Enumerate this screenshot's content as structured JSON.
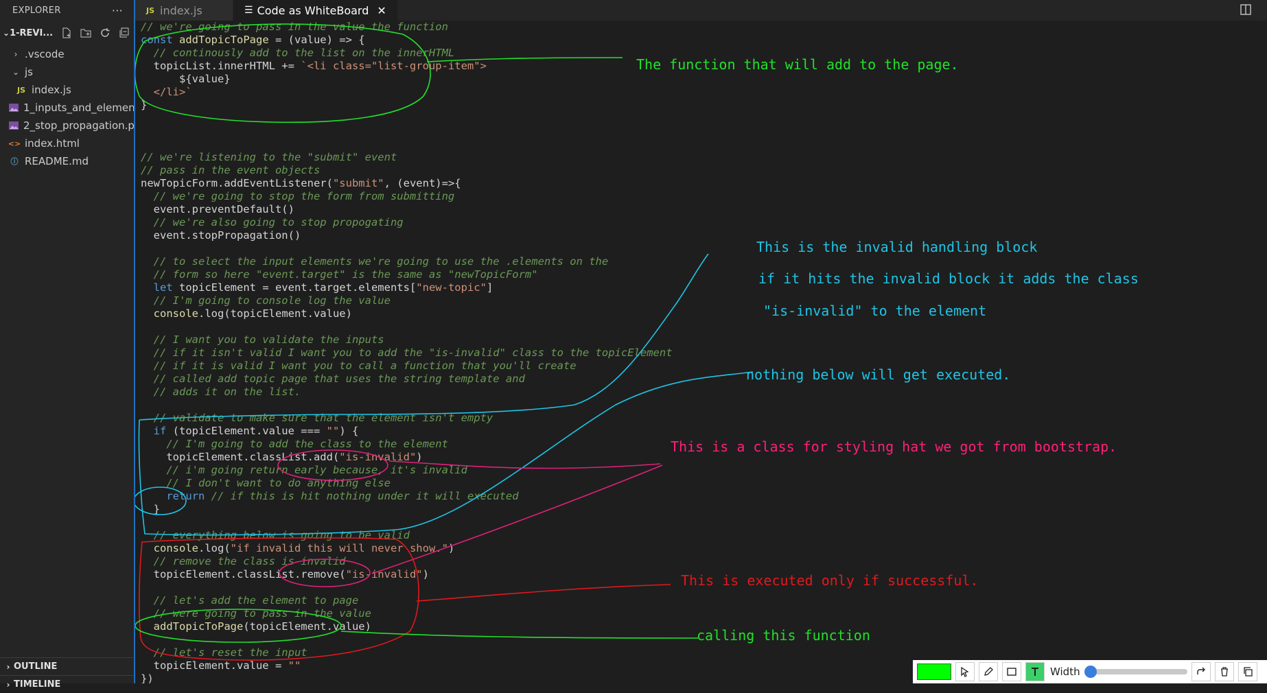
{
  "sidebar": {
    "title": "EXPLORER",
    "more": "···",
    "folder": "1-REVI...",
    "items": [
      {
        "label": ".vscode",
        "type": "folder-closed"
      },
      {
        "label": "js",
        "type": "folder-open"
      },
      {
        "label": "index.js",
        "type": "js"
      },
      {
        "label": "1_inputs_and_elemen...",
        "type": "image"
      },
      {
        "label": "2_stop_propagation.p...",
        "type": "image"
      },
      {
        "label": "index.html",
        "type": "html"
      },
      {
        "label": "README.md",
        "type": "info"
      }
    ],
    "outline": "OUTLINE",
    "timeline": "TIMELINE"
  },
  "tabs": [
    {
      "label": "index.js",
      "icon": "JS"
    },
    {
      "label": "Code as WhiteBoard",
      "close": "✕"
    }
  ],
  "code": [
    [
      [
        "c",
        "// we're going to pass in the value the function"
      ]
    ],
    [
      [
        "k",
        "const "
      ],
      [
        "f",
        "addTopicToPage"
      ],
      [
        "v",
        " = (value) => {"
      ]
    ],
    [
      [
        "c",
        "  // continously add to the list on the innerHTML"
      ]
    ],
    [
      [
        "v",
        "  topicList.innerHTML += "
      ],
      [
        "s",
        "`<li class=\"list-group-item\">"
      ]
    ],
    [
      [
        "v",
        "      ${value}"
      ]
    ],
    [
      [
        "s",
        "  </li>`"
      ]
    ],
    [
      [
        "v",
        "}"
      ]
    ],
    [
      [
        "v",
        ""
      ]
    ],
    [
      [
        "v",
        ""
      ]
    ],
    [
      [
        "v",
        ""
      ]
    ],
    [
      [
        "c",
        "// we're listening to the \"submit\" event"
      ]
    ],
    [
      [
        "c",
        "// pass in the event objects"
      ]
    ],
    [
      [
        "v",
        "newTopicForm.addEventListener("
      ],
      [
        "s",
        "\"submit\""
      ],
      [
        "v",
        ", (event)=>{"
      ]
    ],
    [
      [
        "c",
        "  // we're going to stop the form from submitting"
      ]
    ],
    [
      [
        "v",
        "  event.preventDefault()"
      ]
    ],
    [
      [
        "c",
        "  // we're also going to stop propogating"
      ]
    ],
    [
      [
        "v",
        "  event.stopPropagation()"
      ]
    ],
    [
      [
        "v",
        ""
      ]
    ],
    [
      [
        "c",
        "  // to select the input elements we're going to use the .elements on the"
      ]
    ],
    [
      [
        "c",
        "  // form so here \"event.target\" is the same as \"newTopicForm\""
      ]
    ],
    [
      [
        "k",
        "  let "
      ],
      [
        "v",
        "topicElement = event.target.elements["
      ],
      [
        "s",
        "\"new-topic\""
      ],
      [
        "v",
        "]"
      ]
    ],
    [
      [
        "c",
        "  // I'm going to console log the value"
      ]
    ],
    [
      [
        "f",
        "  console"
      ],
      [
        "v",
        ".log(topicElement.value)"
      ]
    ],
    [
      [
        "v",
        ""
      ]
    ],
    [
      [
        "c",
        "  // I want you to validate the inputs"
      ]
    ],
    [
      [
        "c",
        "  // if it isn't valid I want you to add the \"is-invalid\" class to the topicElement"
      ]
    ],
    [
      [
        "c",
        "  // if it is valid I want you to call a function that you'll create"
      ]
    ],
    [
      [
        "c",
        "  // called add topic page that uses the string template and"
      ]
    ],
    [
      [
        "c",
        "  // adds it on the list."
      ]
    ],
    [
      [
        "v",
        ""
      ]
    ],
    [
      [
        "c",
        "  // validate to make sure that the element isn't empty"
      ]
    ],
    [
      [
        "k",
        "  if "
      ],
      [
        "v",
        "(topicElement.value === "
      ],
      [
        "s",
        "\"\""
      ],
      [
        "v",
        ") {"
      ]
    ],
    [
      [
        "c",
        "    // I'm going to add the class to the element"
      ]
    ],
    [
      [
        "v",
        "    topicElement.classList.add("
      ],
      [
        "s",
        "\"is-invalid\""
      ],
      [
        "v",
        ")"
      ]
    ],
    [
      [
        "c",
        "    // i'm going return early because, it's invalid"
      ]
    ],
    [
      [
        "c",
        "    // I don't want to do anything else"
      ]
    ],
    [
      [
        "k",
        "    return "
      ],
      [
        "c",
        "// if this is hit nothing under it will executed"
      ]
    ],
    [
      [
        "v",
        "  }"
      ]
    ],
    [
      [
        "v",
        ""
      ]
    ],
    [
      [
        "c",
        "  // everything below is going to be valid"
      ]
    ],
    [
      [
        "f",
        "  console"
      ],
      [
        "v",
        ".log("
      ],
      [
        "s",
        "\"if invalid this will never show.\""
      ],
      [
        "v",
        ")"
      ]
    ],
    [
      [
        "c",
        "  // remove the class is-invalid"
      ]
    ],
    [
      [
        "v",
        "  topicElement.classList.remove("
      ],
      [
        "s",
        "\"is-invalid\""
      ],
      [
        "v",
        ")"
      ]
    ],
    [
      [
        "v",
        ""
      ]
    ],
    [
      [
        "c",
        "  // let's add the element to page"
      ]
    ],
    [
      [
        "c",
        "  // were going to pass in the value"
      ]
    ],
    [
      [
        "f",
        "  addTopicToPage"
      ],
      [
        "v",
        "(topicElement.value)"
      ]
    ],
    [
      [
        "v",
        ""
      ]
    ],
    [
      [
        "c",
        "  // let's reset the input"
      ]
    ],
    [
      [
        "v",
        "  topicElement.value = "
      ],
      [
        "s",
        "\"\""
      ]
    ],
    [
      [
        "v",
        "})"
      ]
    ]
  ],
  "annotations": [
    {
      "text": "The function that will add to the page.",
      "color": "#22e12a"
    },
    {
      "text": "This is the invalid handling block",
      "color": "#1fc4e6"
    },
    {
      "text": "if it hits the invalid block it adds the class",
      "color": "#1fc4e6"
    },
    {
      "text": "\"is-invalid\" to the element",
      "color": "#1fc4e6"
    },
    {
      "text": "nothing  below will get executed.",
      "color": "#1fc4e6"
    },
    {
      "text": "This is a class for styling hat we got from bootstrap.",
      "color": "#ff1f7a"
    },
    {
      "text": "This is executed only if successful.",
      "color": "#e0191e"
    },
    {
      "text": "calling this function",
      "color": "#22e12a"
    }
  ],
  "toolbar": {
    "color": "#00ff00",
    "width_label": "Width",
    "width_value": 0.05,
    "active_tool": "text-tool"
  }
}
